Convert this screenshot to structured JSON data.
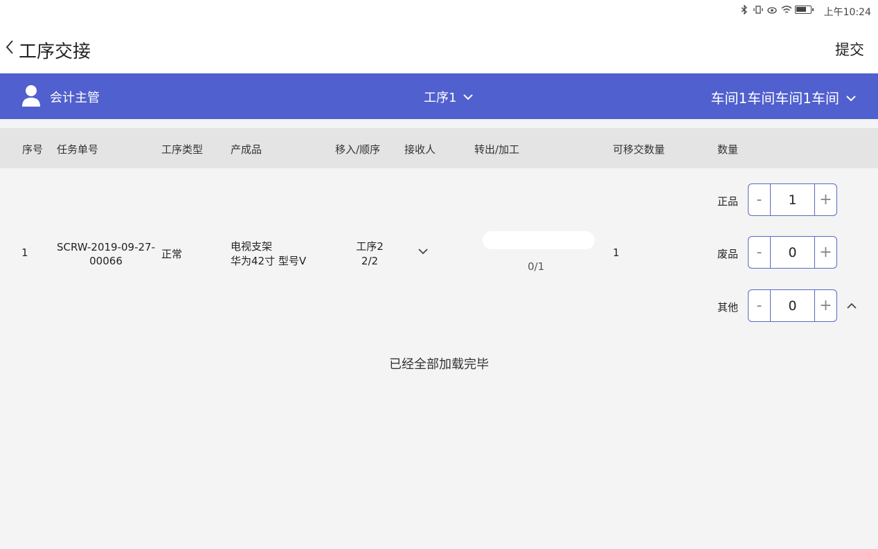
{
  "status": {
    "time": "上午10:24"
  },
  "title": {
    "text": "工序交接",
    "submit_label": "提交"
  },
  "filters": {
    "user_name": "会计主管",
    "process": "工序1",
    "workshop": "车间1车间车间1车间"
  },
  "table": {
    "headers": [
      "序号",
      "任务单号",
      "工序类型",
      "产成品",
      "移入/顺序",
      "接收人",
      "转出/加工",
      "可移交数量",
      "数量"
    ],
    "rows": [
      {
        "index": "1",
        "task_no_line1": "SCRW-2019-09-27-",
        "task_no_line2": "00066",
        "process_type": "正常",
        "product_line1": "电视支架",
        "product_line2": "华为42寸 型号V",
        "move_in_line1": "工序2",
        "move_in_line2": "2/2",
        "transfer_count": "0/1",
        "transferable_qty": "1",
        "quantities": [
          {
            "label": "正品",
            "value": "1"
          },
          {
            "label": "废品",
            "value": "0"
          },
          {
            "label": "其他",
            "value": "0"
          }
        ]
      }
    ]
  },
  "stepper": {
    "minus": "-",
    "plus": "+"
  },
  "footer": {
    "loaded_message": "已经全部加载完毕"
  }
}
